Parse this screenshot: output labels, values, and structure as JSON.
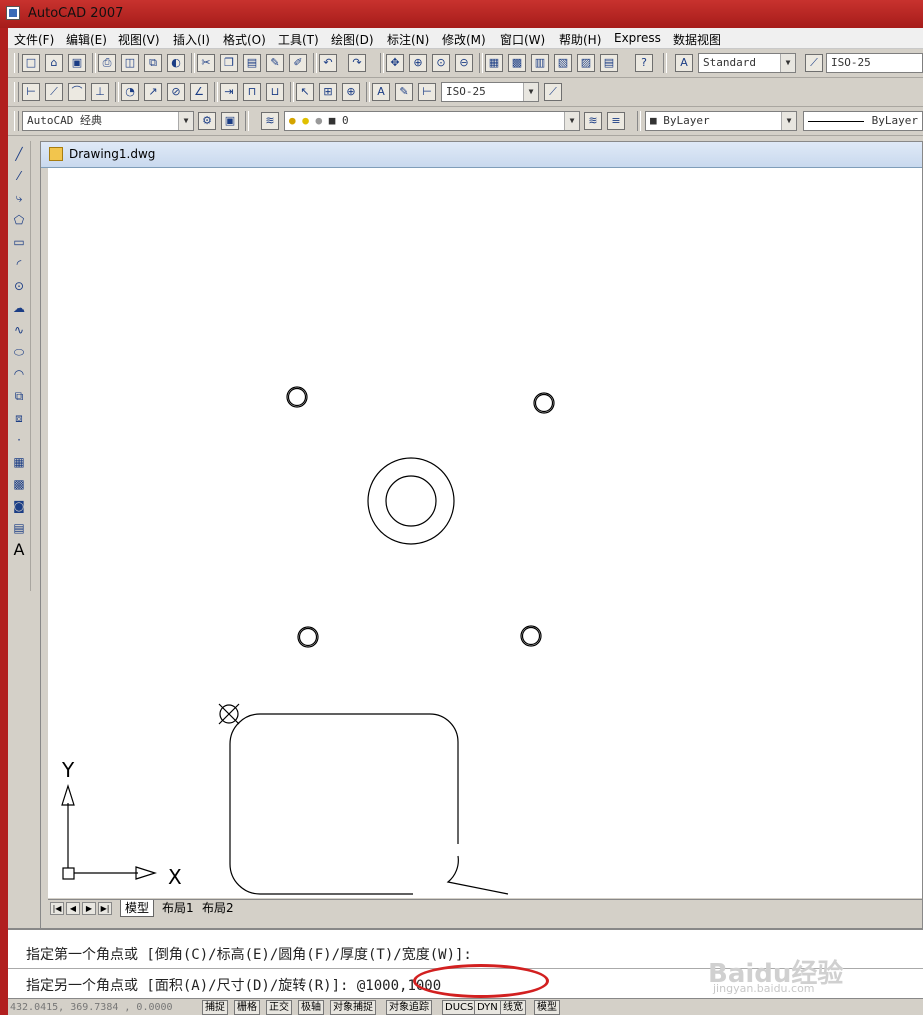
{
  "app": {
    "title": "AutoCAD 2007"
  },
  "menu": [
    "文件(F)",
    "编辑(E)",
    "视图(V)",
    "插入(I)",
    "格式(O)",
    "工具(T)",
    "绘图(D)",
    "标注(N)",
    "修改(M)",
    "窗口(W)",
    "帮助(H)",
    "Express",
    "数据视图"
  ],
  "toolbar1": {
    "text_style": "Standard",
    "dim_style": "ISO-25"
  },
  "toolbar2": {
    "dim_style_combo": "ISO-25"
  },
  "toolbar3": {
    "workspace": "AutoCAD 经典",
    "layer": "0",
    "color": "ByLayer",
    "linetype": "ByLayer"
  },
  "left_tools": [
    "line-icon",
    "construction-line-icon",
    "polyline-icon",
    "polygon-icon",
    "rectangle-icon",
    "arc-icon",
    "circle-icon",
    "revcloud-icon",
    "spline-icon",
    "ellipse-icon",
    "ellipse-arc-icon",
    "insert-block-icon",
    "make-block-icon",
    "point-icon",
    "hatch-icon",
    "gradient-icon",
    "region-icon",
    "table-icon",
    "multiline-text-icon"
  ],
  "document": {
    "name": "Drawing1.dwg"
  },
  "ucs": {
    "x_label": "X",
    "y_label": "Y"
  },
  "tabs": [
    "模型",
    "布局1",
    "布局2"
  ],
  "command": {
    "line1": "指定第一个角点或 [倒角(C)/标高(E)/圆角(F)/厚度(T)/宽度(W)]:",
    "line2": "指定另一个角点或 [面积(A)/尺寸(D)/旋转(R)]:",
    "input": "@1000,1000"
  },
  "watermark": {
    "brand": "Baidu经验",
    "url": "jingyan.baidu.com"
  },
  "status": {
    "coords": "432.0415,  369.7384 , 0.0000",
    "buttons": [
      "捕捉",
      "栅格",
      "正交",
      "极轴",
      "对象捕捉",
      "对象追踪",
      "DUCS",
      "DYN",
      "线宽",
      "模型"
    ]
  }
}
